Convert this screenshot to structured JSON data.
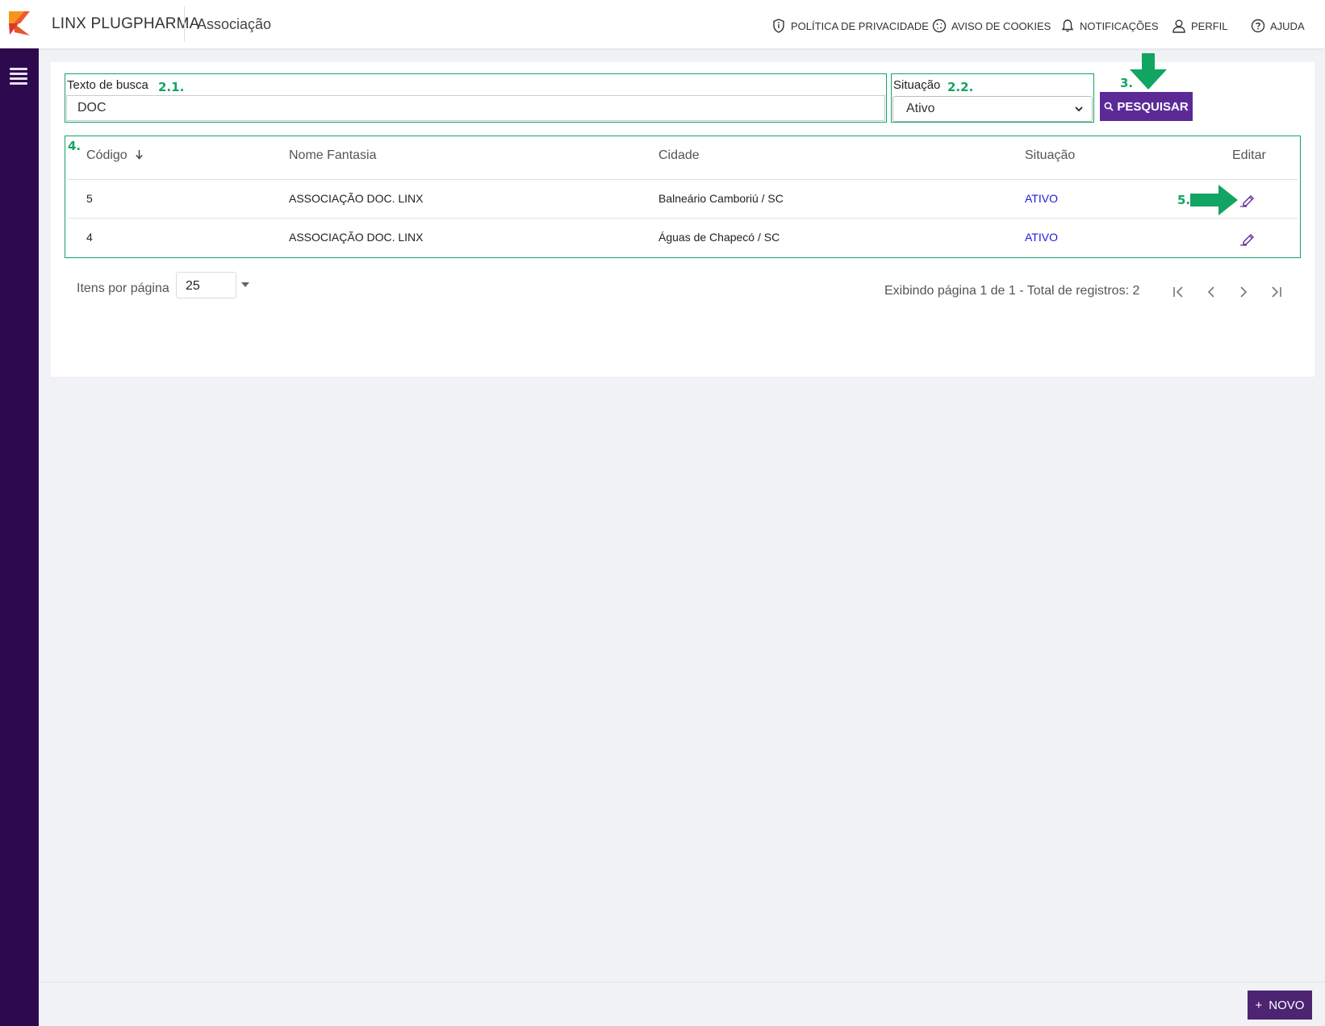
{
  "header": {
    "brand": "LINX PLUGPHARMA",
    "page_title": "Associação",
    "nav": [
      {
        "label": "POLÍTICA DE PRIVACIDADE",
        "icon": "shield-icon"
      },
      {
        "label": "AVISO DE COOKIES",
        "icon": "cookie-icon"
      },
      {
        "label": "NOTIFICAÇÕES",
        "icon": "bell-icon"
      },
      {
        "label": "PERFIL",
        "icon": "user-icon"
      },
      {
        "label": "AJUDA",
        "icon": "help-icon"
      }
    ]
  },
  "filters": {
    "search_label": "Texto de busca",
    "search_step": "2.1.",
    "search_value": "DOC",
    "status_label": "Situação",
    "status_step": "2.2.",
    "status_value": "Ativo",
    "search_button": "PESQUISAR",
    "search_button_step": "3."
  },
  "table": {
    "step": "4.",
    "edit_step": "5.",
    "columns": [
      "Código",
      "Nome Fantasia",
      "Cidade",
      "Situação",
      "Editar"
    ],
    "rows": [
      {
        "codigo": "5",
        "nome": "ASSOCIAÇÃO DOC. LINX",
        "cidade": "Balneário Camboriú / SC",
        "situacao": "ATIVO"
      },
      {
        "codigo": "4",
        "nome": "ASSOCIAÇÃO DOC. LINX",
        "cidade": "Águas de Chapecó / SC",
        "situacao": "ATIVO"
      }
    ]
  },
  "pagination": {
    "per_page_label": "Itens por página",
    "per_page_value": "25",
    "info": "Exibindo página 1 de 1 - Total de registros: 2"
  },
  "footer": {
    "new_button": "NOVO",
    "new_icon": "+"
  },
  "colors": {
    "sidebar": "#2d0a4e",
    "accent_purple": "#5b2a97",
    "annotation_green": "#12a462",
    "status_blue": "#1a1ae0"
  }
}
